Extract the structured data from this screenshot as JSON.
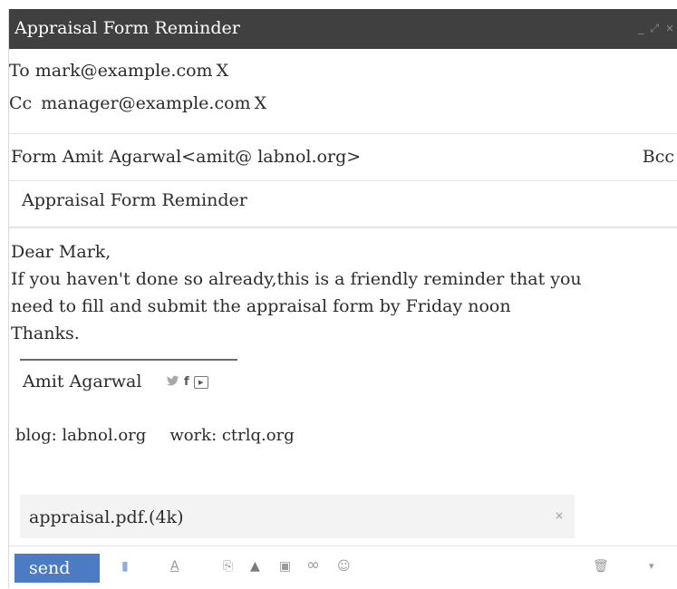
{
  "window": {
    "title": "Appraisal Form Reminder",
    "controls": [
      {
        "icon": "minimize-icon",
        "glyph": "_"
      },
      {
        "icon": "expand-icon",
        "glyph": "⤢"
      },
      {
        "icon": "close-icon",
        "glyph": "×"
      }
    ]
  },
  "to": {
    "label": "To",
    "address": "mark@example.com",
    "remove": "X"
  },
  "cc": {
    "label": "Cc",
    "address": "manager@example.com",
    "remove": "X"
  },
  "from": {
    "text": "Form Amit Agarwal<amit@ labnol.org>"
  },
  "bcc_label": "Bcc",
  "subject": "Appraisal Form Reminder",
  "body": {
    "greeting": "Dear Mark,",
    "line1": "If you haven't done so already,this is a friendly reminder that you",
    "line2": "need to fill and submit the appraisal form by Friday noon",
    "closing": "Thanks."
  },
  "signature": {
    "name": "Amit Agarwal",
    "icons": [
      "twitter-icon",
      "facebook-icon",
      "youtube-icon"
    ],
    "facebook_glyph": "f",
    "youtube_glyph": "▶",
    "twitter_glyph": "🐦",
    "blog": "blog: labnol.org",
    "work": "work: ctrlq.org"
  },
  "attachment": {
    "name": "appraisal.pdf.(4k)",
    "remove": "×"
  },
  "toolbar": {
    "send_label": "send",
    "tools": [
      {
        "icon": "formatting-icon",
        "glyph": "▮"
      },
      {
        "icon": "text-color-icon",
        "glyph": "A"
      },
      {
        "icon": "attach-file-icon",
        "glyph": "⎘"
      },
      {
        "icon": "drive-icon",
        "glyph": "▲"
      },
      {
        "icon": "insert-photo-icon",
        "glyph": "▣"
      },
      {
        "icon": "insert-link-icon",
        "glyph": "∞"
      },
      {
        "icon": "emoji-icon",
        "glyph": "☺"
      }
    ],
    "trash_glyph": "🗑",
    "more_glyph": "▾"
  },
  "colors": {
    "titlebar": "#404040",
    "send_button": "#4d7ac4"
  }
}
